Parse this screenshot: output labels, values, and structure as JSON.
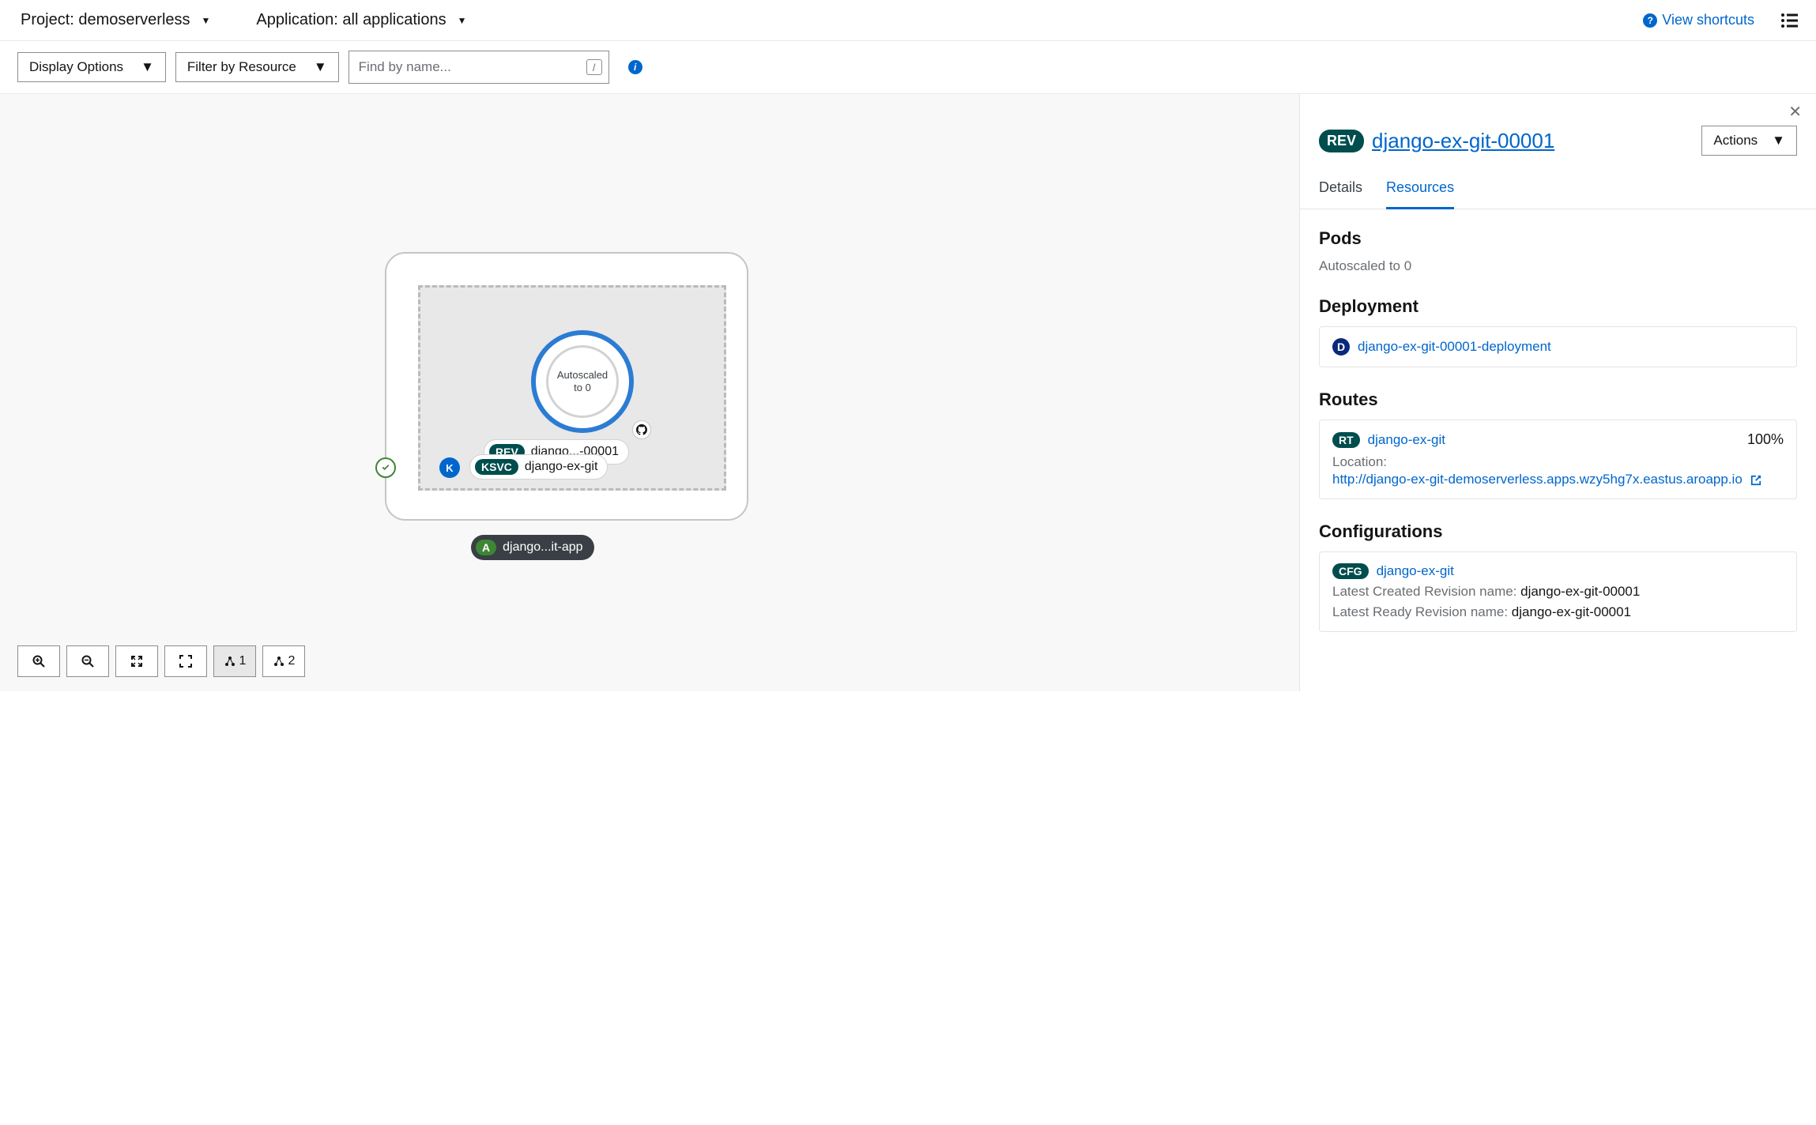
{
  "header": {
    "project_label_prefix": "Project: ",
    "project_name": "demoserverless",
    "application_label_prefix": "Application: ",
    "application_name": "all applications",
    "shortcuts_label": "View shortcuts"
  },
  "toolbar": {
    "display_options_label": "Display Options",
    "filter_label": "Filter by Resource",
    "find_placeholder": "Find by name...",
    "key_hint": "/"
  },
  "topology": {
    "node": {
      "autoscaled_line1": "Autoscaled",
      "autoscaled_line2": "to 0"
    },
    "rev_badge": "REV",
    "rev_label": "django...-00001",
    "ksvc_badge": "KSVC",
    "ksvc_label": "django-ex-git",
    "kn_badge": "K",
    "app_badge": "A",
    "app_label": "django...it-app"
  },
  "zoom": {
    "graph1": "1",
    "graph2": "2"
  },
  "panel": {
    "badge": "REV",
    "title": "django-ex-git-00001",
    "actions_label": "Actions",
    "tabs": {
      "details": "Details",
      "resources": "Resources"
    },
    "pods": {
      "heading": "Pods",
      "text": "Autoscaled to 0"
    },
    "deployment": {
      "heading": "Deployment",
      "badge": "D",
      "name": "django-ex-git-00001-deployment"
    },
    "routes": {
      "heading": "Routes",
      "badge": "RT",
      "name": "django-ex-git",
      "percent": "100%",
      "location_label": "Location:",
      "url": "http://django-ex-git-demoserverless.apps.wzy5hg7x.eastus.aroapp.io"
    },
    "config": {
      "heading": "Configurations",
      "badge": "CFG",
      "name": "django-ex-git",
      "created_label": "Latest Created Revision name: ",
      "created_val": "django-ex-git-00001",
      "ready_label": "Latest Ready Revision name: ",
      "ready_val": "django-ex-git-00001"
    }
  }
}
